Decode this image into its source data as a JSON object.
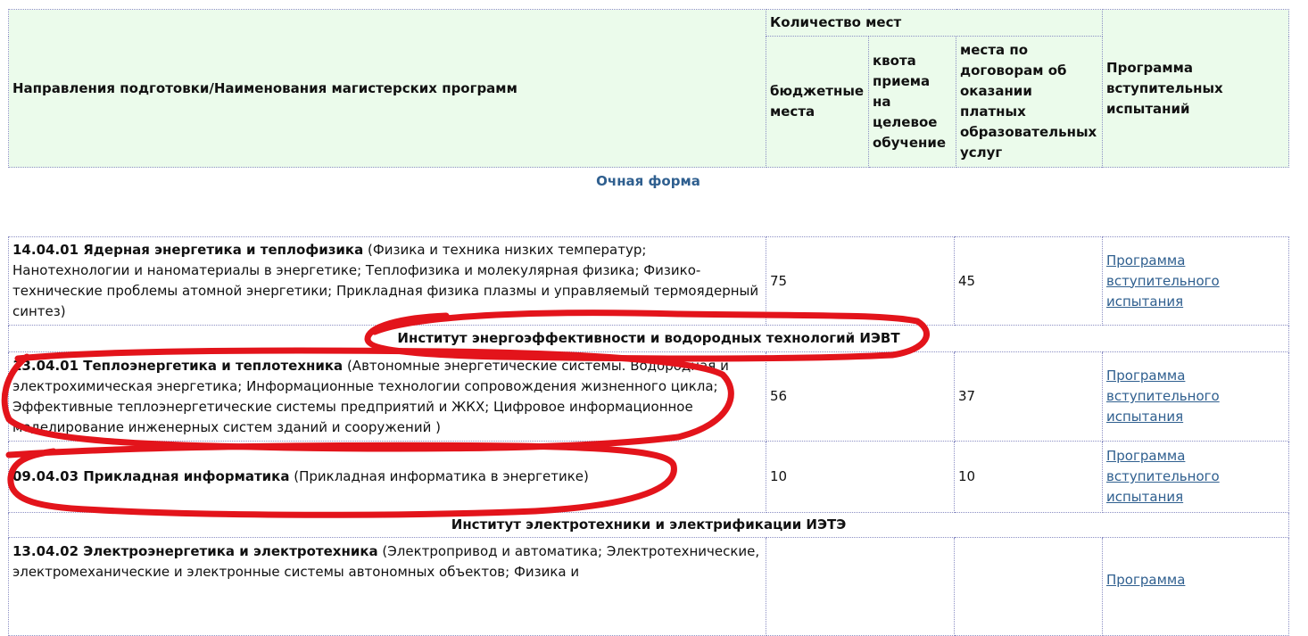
{
  "header": {
    "col_program": "Направления подготовки/Наименования магистерских программ",
    "col_places": "Количество мест",
    "col_budget": "бюджетные места",
    "col_quota": "квота приема на целевое обучение",
    "col_contract": "места по договорам об оказании платных образовательных услуг",
    "col_exam": "Программа вступительных испытаний"
  },
  "form_label": "Очная форма",
  "rows": [
    {
      "code": "14.04.01 Ядерная энергетика и теплофизика",
      "desc": " (Физика и техника низких температур; Нанотехнологии и наноматериалы в энергетике; Теплофизика и молекулярная физика; Физико-технические проблемы атомной энергетики; Прикладная физика плазмы и управляемый термоядерный синтез)",
      "budget": "75",
      "quota": "",
      "contract": "45",
      "exam_link": "Программа вступительного испытания"
    },
    {
      "institute": "Институт энергоэффективности и водородных технологий ИЭВТ"
    },
    {
      "code": "13.04.01 Теплоэнергетика и теплотехника",
      "desc": " (Автономные энергетические системы. Водородная и электрохимическая энергетика; Информационные технологии сопровождения жизненного цикла; Эффективные теплоэнергетические системы предприятий и ЖКХ; Цифровое информационное моделирование инженерных систем зданий и сооружений )",
      "budget": "56",
      "quota": "",
      "contract": "37",
      "exam_link": "Программа вступительного испытания"
    },
    {
      "code": "09.04.03 Прикладная информатика",
      "desc": " (Прикладная информатика в энергетике)",
      "budget": "10",
      "quota": "",
      "contract": "10",
      "exam_link": "Программа вступительного испытания"
    },
    {
      "institute": "Институт электротехники и электрификации ИЭТЭ"
    },
    {
      "code": "13.04.02 Электроэнергетика и электротехника",
      "desc": " (Электропривод и автоматика; Электротехнические, электромеханические и электронные системы автономных объектов; Физика и",
      "budget": "",
      "quota": "",
      "contract": "",
      "exam_link": "Программа"
    }
  ],
  "colors": {
    "header_bg": "#ebfbeb",
    "link": "#2f5f8f",
    "border": "#8c8fc4",
    "annotation": "#e3141b"
  }
}
